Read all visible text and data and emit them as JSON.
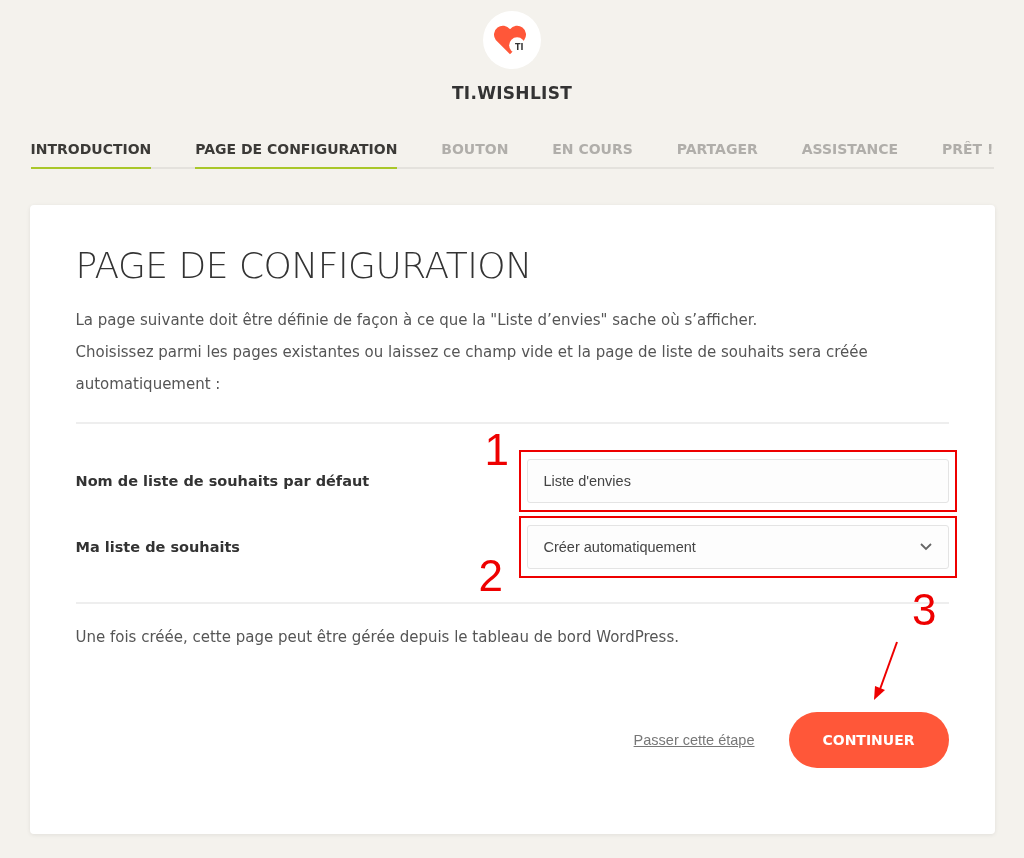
{
  "brand": {
    "name": "TI.WISHLIST",
    "badge": "TI"
  },
  "steps": [
    {
      "label": "INTRODUCTION",
      "completed": true
    },
    {
      "label": "PAGE DE CONFIGURATION",
      "completed": true
    },
    {
      "label": "BOUTON",
      "completed": false
    },
    {
      "label": "EN COURS",
      "completed": false
    },
    {
      "label": "PARTAGER",
      "completed": false
    },
    {
      "label": "ASSISTANCE",
      "completed": false
    },
    {
      "label": "PRÊT !",
      "completed": false
    }
  ],
  "card": {
    "title": "PAGE DE CONFIGURATION",
    "intro": [
      "La page suivante doit être définie de façon à ce que la \"Liste d’envies\" sache où s’afficher.",
      "Choisissez parmi les pages existantes ou laissez ce champ vide et la page de liste de souhaits sera créée automatiquement :"
    ],
    "fields": [
      {
        "kind": "text",
        "label": "Nom de liste de souhaits par défaut",
        "value": "Liste d'envies",
        "marker": "1"
      },
      {
        "kind": "select",
        "label": "Ma liste de souhaits",
        "value": "Créer automatiquement",
        "marker": "2"
      }
    ],
    "note": "Une fois créée, cette page peut être gérée depuis le tableau de bord WordPress.",
    "skip_link": "Passer cette étape",
    "continue_button": "CONTINUER",
    "button_marker": "3"
  }
}
